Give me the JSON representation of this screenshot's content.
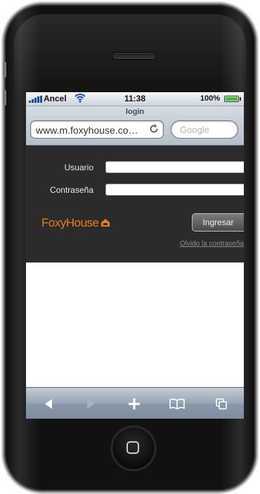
{
  "status_bar": {
    "carrier": "Ancel",
    "time": "11:38",
    "battery_percent": "100%",
    "battery_level": 1.0,
    "icons": [
      "signal-bars-icon",
      "wifi-icon",
      "battery-icon"
    ]
  },
  "browser": {
    "page_title": "login",
    "url": "www.m.foxyhouse.co…",
    "search_placeholder": "Google",
    "icons": [
      "reload-icon"
    ]
  },
  "login": {
    "username_label": "Usuario",
    "password_label": "Contraseña",
    "username_value": "",
    "password_value": "",
    "submit_label": "Ingresar",
    "forgot_label": "Olvido la contraseña"
  },
  "brand": {
    "prefix": "Foxy",
    "suffix": "House",
    "color": "#ee7b1c"
  },
  "toolbar": {
    "icons": [
      "back-arrow-icon",
      "forward-arrow-icon",
      "add-bookmark-icon",
      "bookmarks-icon",
      "pages-icon"
    ],
    "forward_enabled": false
  },
  "colors": {
    "panel_background": "#2b2b2b",
    "toolbar_blue": "#8998a8",
    "brand_orange": "#ee7b1c"
  }
}
